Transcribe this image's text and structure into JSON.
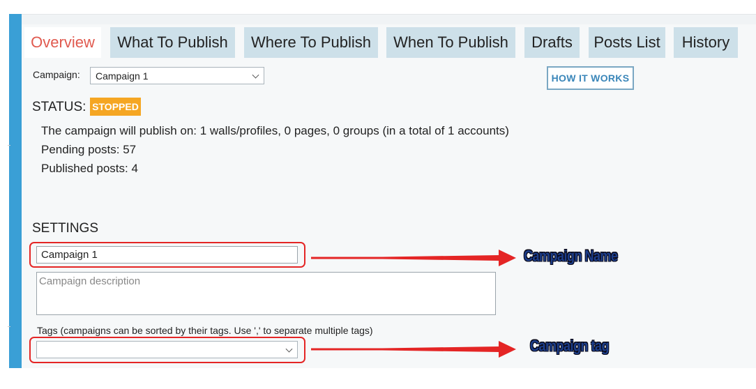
{
  "tabs": [
    {
      "label": "Overview",
      "active": true
    },
    {
      "label": "What To Publish",
      "active": false
    },
    {
      "label": "Where To Publish",
      "active": false
    },
    {
      "label": "When To Publish",
      "active": false
    },
    {
      "label": "Drafts",
      "active": false
    },
    {
      "label": "Posts List",
      "active": false
    },
    {
      "label": "History",
      "active": false
    }
  ],
  "campaign_select": {
    "label": "Campaign:",
    "value": "Campaign 1"
  },
  "how_it_works_label": "HOW IT WORKS",
  "status": {
    "label": "STATUS:",
    "badge": "STOPPED",
    "badge_color": "#f5a623"
  },
  "info": {
    "publish_on": "The campaign will publish on: 1 walls/profiles, 0 pages, 0 groups (in a total of 1 accounts)",
    "pending": "Pending posts: 57",
    "published": "Published posts: 4"
  },
  "settings": {
    "heading": "SETTINGS",
    "name_value": "Campaign 1",
    "description_placeholder": "Campaign description",
    "tags_label": "Tags (campaigns can be sorted by their tags. Use ',' to separate multiple tags)",
    "tags_value": ""
  },
  "annotations": {
    "name_callout": "Campaign Name",
    "tag_callout": "Campaign tag",
    "color": "#e42525"
  },
  "colors": {
    "sidebar": "#3a9fd6",
    "tab_bg": "#cde0e9",
    "active_tab_text": "#e05a4f"
  }
}
